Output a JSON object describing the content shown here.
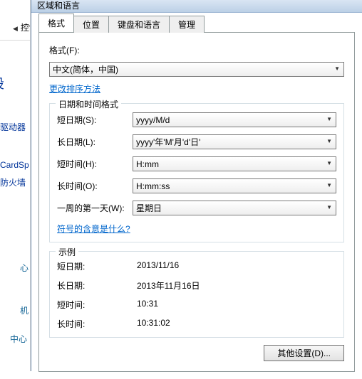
{
  "window_title": "区域和语言",
  "left_panel": {
    "breadcrumb": "控制",
    "page_title": "的设",
    "links": {
      "l1": "驱动器",
      "l2": "CardSp",
      "l3": "防火墙",
      "l4": "心",
      "l5": "机",
      "l6": "中心"
    }
  },
  "tabs": {
    "t0": "格式",
    "t1": "位置",
    "t2": "键盘和语言",
    "t3": "管理"
  },
  "format_label": "格式(F):",
  "format_value": "中文(简体，中国)",
  "change_sort_link": "更改排序方法",
  "group_datetime": {
    "legend": "日期和时间格式",
    "short_date_label": "短日期(S):",
    "short_date_value": "yyyy/M/d",
    "long_date_label": "长日期(L):",
    "long_date_value": "yyyy'年'M'月'd'日'",
    "short_time_label": "短时间(H):",
    "short_time_value": "H:mm",
    "long_time_label": "长时间(O):",
    "long_time_value": "H:mm:ss",
    "first_day_label": "一周的第一天(W):",
    "first_day_value": "星期日",
    "notation_link": "符号的含意是什么?"
  },
  "group_example": {
    "legend": "示例",
    "short_date_label": "短日期:",
    "short_date_value": "2013/11/16",
    "long_date_label": "长日期:",
    "long_date_value": "2013年11月16日",
    "short_time_label": "短时间:",
    "short_time_value": "10:31",
    "long_time_label": "长时间:",
    "long_time_value": "10:31:02"
  },
  "other_settings_btn": "其他设置(D)..."
}
